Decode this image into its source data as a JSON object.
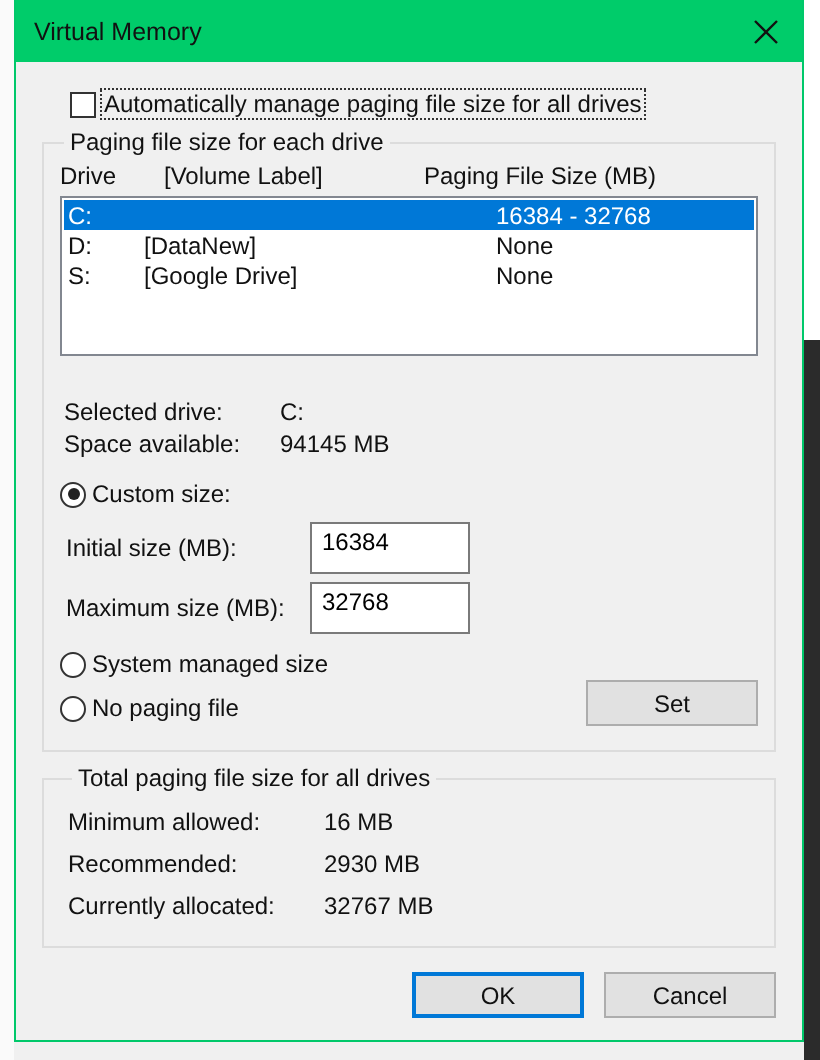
{
  "window": {
    "title": "Virtual Memory"
  },
  "auto_manage": {
    "label": "Automatically manage paging file size for all drives",
    "checked": false
  },
  "drive_group": {
    "title": "Paging file size for each drive",
    "columns": [
      "Drive",
      "[Volume Label]",
      "Paging File Size (MB)"
    ],
    "rows": [
      {
        "drive": "C:",
        "label": "",
        "size": "16384 - 32768",
        "selected": true
      },
      {
        "drive": "D:",
        "label": "[DataNew]",
        "size": "None",
        "selected": false
      },
      {
        "drive": "S:",
        "label": "[Google Drive]",
        "size": "None",
        "selected": false
      }
    ],
    "info": [
      {
        "label": "Selected drive:",
        "value": "C:"
      },
      {
        "label": "Space available:",
        "value": "94145 MB"
      }
    ],
    "custom_size": {
      "label": "Custom size:",
      "selected": true
    },
    "fields": [
      {
        "label": "Initial size (MB):",
        "value": "16384"
      },
      {
        "label": "Maximum size (MB):",
        "value": "32768"
      }
    ],
    "system_managed": {
      "label": "System managed size",
      "selected": false
    },
    "no_paging": {
      "label": "No paging file",
      "selected": false
    },
    "set_button": "Set"
  },
  "total_group": {
    "title": "Total paging file size for all drives",
    "rows": [
      {
        "label": "Minimum allowed:",
        "value": "16 MB"
      },
      {
        "label": "Recommended:",
        "value": "2930 MB"
      },
      {
        "label": "Currently allocated:",
        "value": "32767 MB"
      }
    ]
  },
  "buttons": [
    {
      "label": "OK",
      "default": true
    },
    {
      "label": "Cancel",
      "default": false
    }
  ]
}
